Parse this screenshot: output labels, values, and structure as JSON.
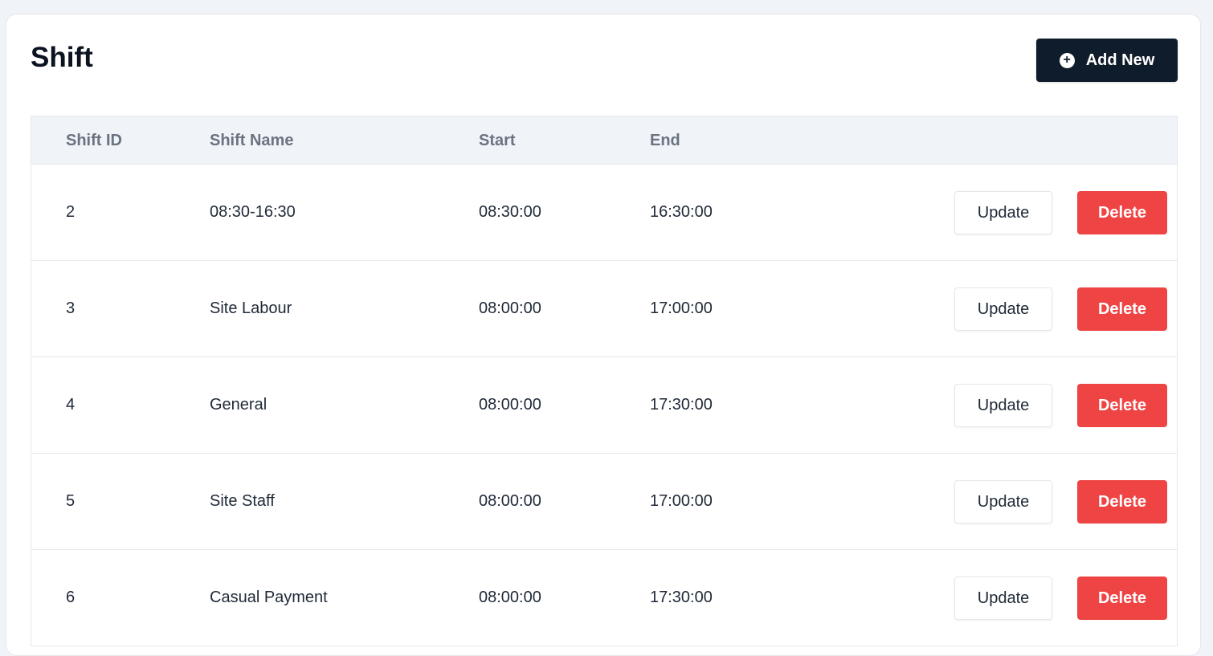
{
  "page": {
    "title": "Shift"
  },
  "toolbar": {
    "add_label": "Add New",
    "add_icon": "plus-circle-icon"
  },
  "table": {
    "columns": [
      "Shift ID",
      "Shift Name",
      "Start",
      "End"
    ],
    "rows": [
      {
        "id": "2",
        "name": "08:30-16:30",
        "start": "08:30:00",
        "end": "16:30:00",
        "update_label": "Update",
        "delete_label": "Delete"
      },
      {
        "id": "3",
        "name": "Site Labour",
        "start": "08:00:00",
        "end": "17:00:00",
        "update_label": "Update",
        "delete_label": "Delete"
      },
      {
        "id": "4",
        "name": "General",
        "start": "08:00:00",
        "end": "17:30:00",
        "update_label": "Update",
        "delete_label": "Delete"
      },
      {
        "id": "5",
        "name": "Site Staff",
        "start": "08:00:00",
        "end": "17:00:00",
        "update_label": "Update",
        "delete_label": "Delete"
      },
      {
        "id": "6",
        "name": "Casual Payment",
        "start": "08:00:00",
        "end": "17:30:00",
        "update_label": "Update",
        "delete_label": "Delete"
      }
    ]
  },
  "colors": {
    "primary_button": "#0f1c2b",
    "delete_button": "#ef4444",
    "header_bg": "#f0f3f8"
  }
}
